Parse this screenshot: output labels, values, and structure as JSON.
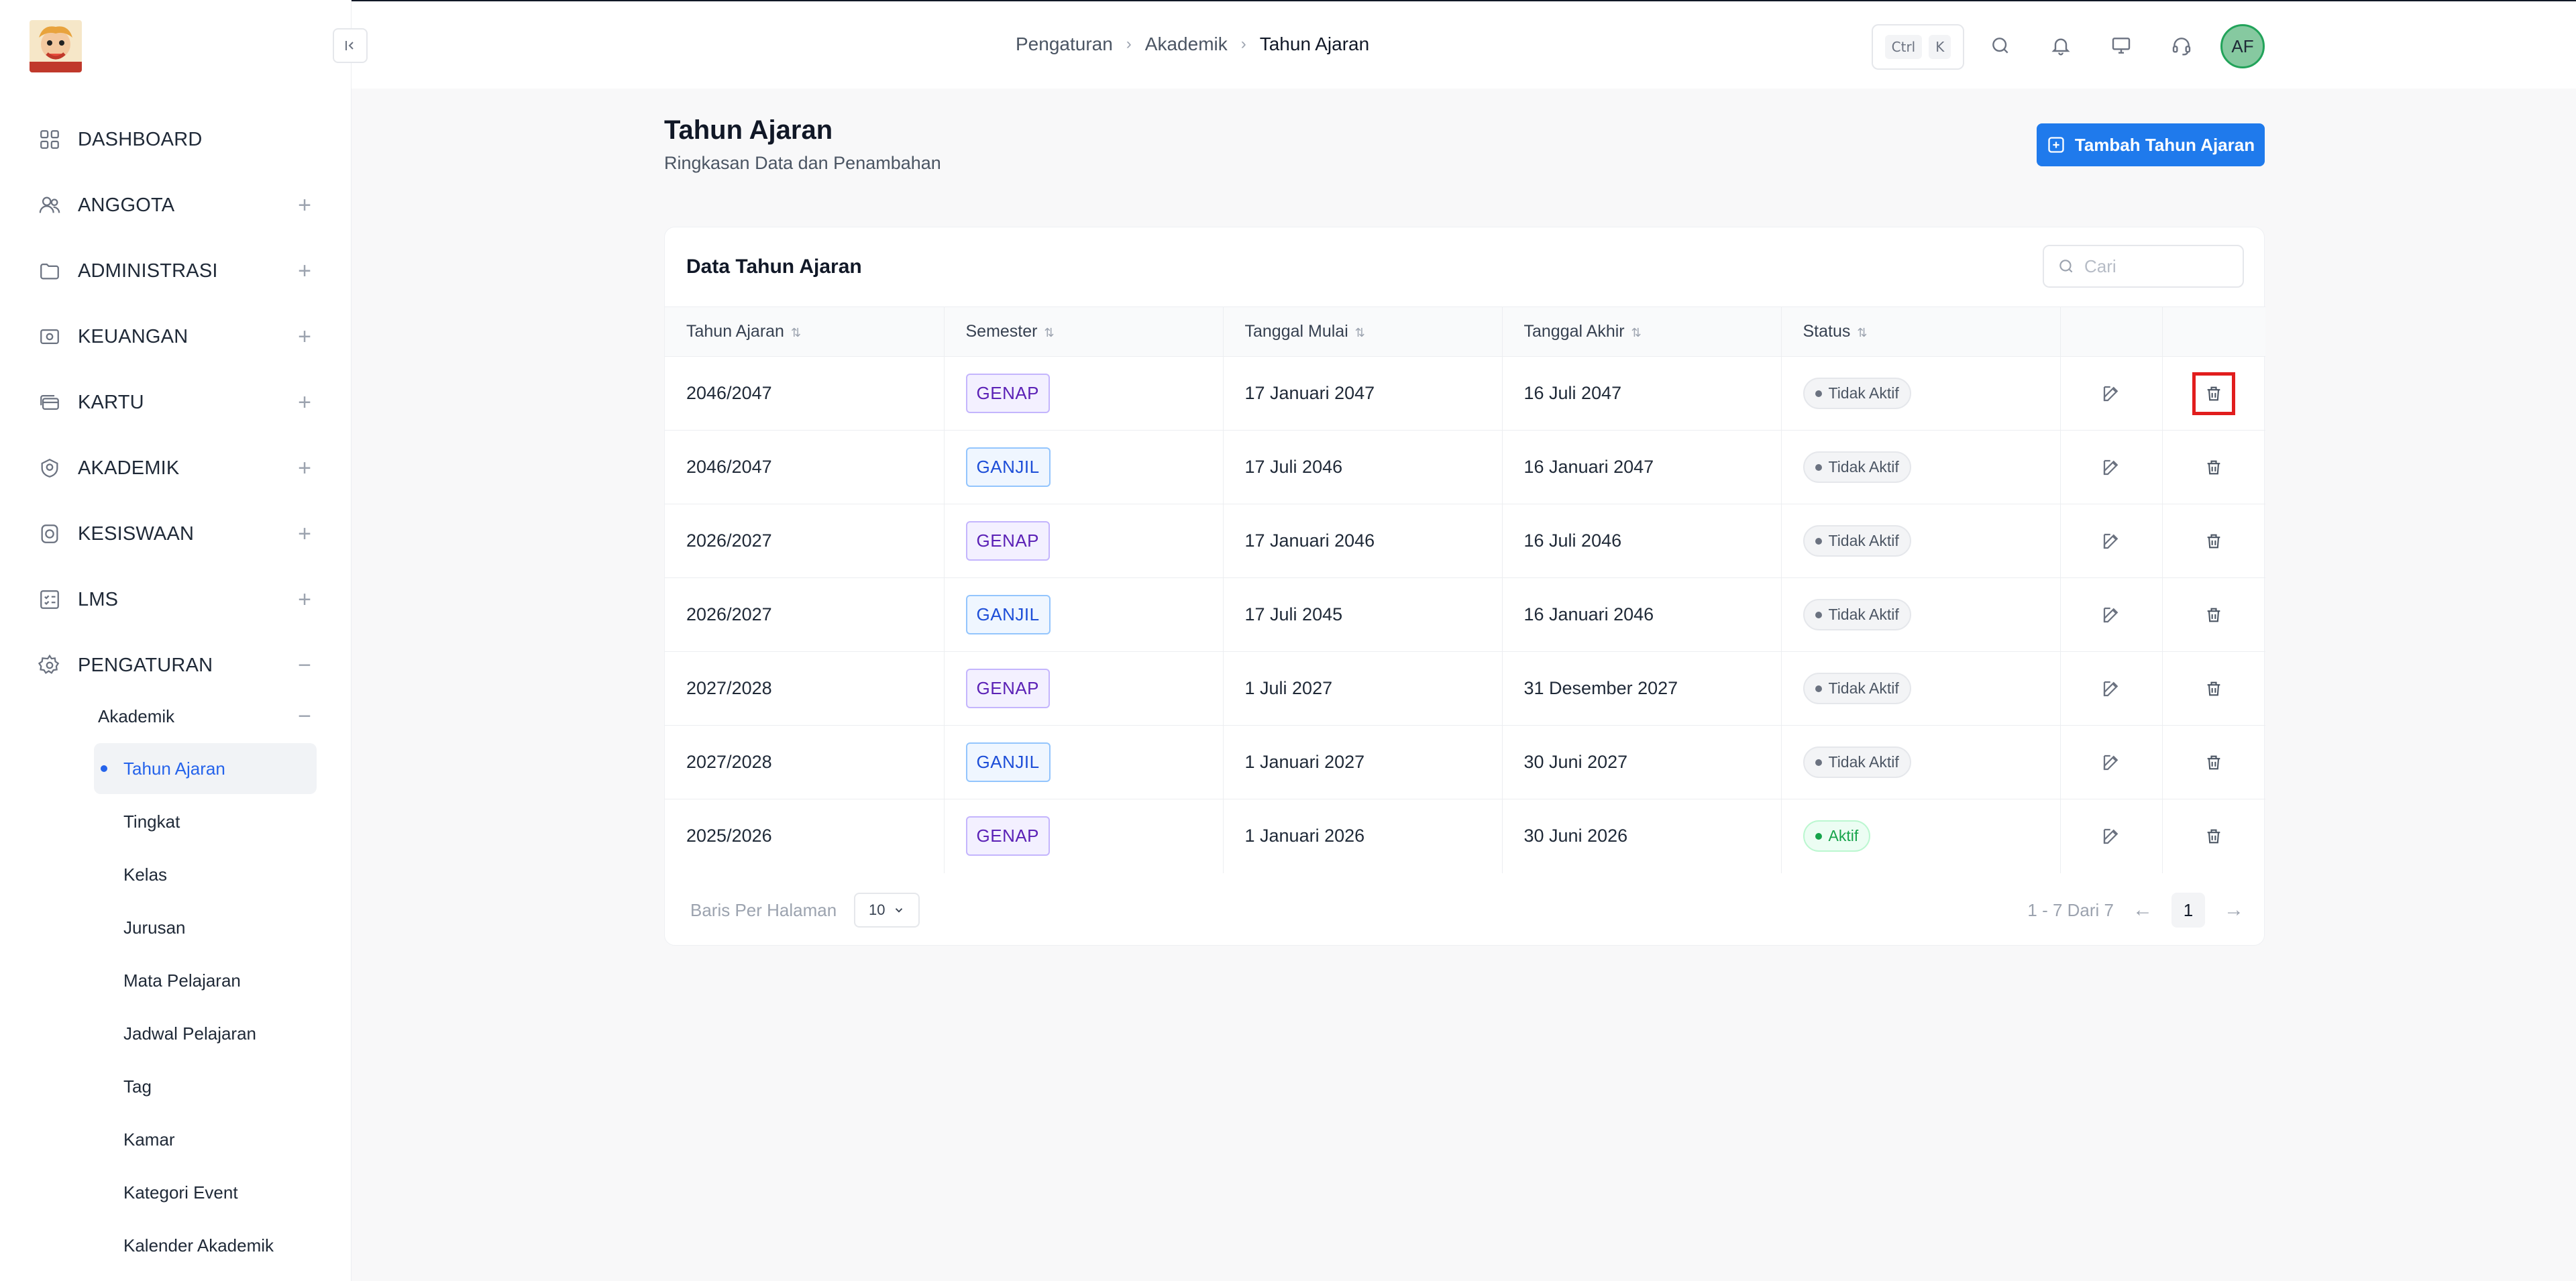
{
  "sidebar": {
    "collapse_icon": "collapse-left-icon",
    "items": [
      {
        "label": "DASHBOARD",
        "icon": "grid-icon",
        "expandable": false
      },
      {
        "label": "ANGGOTA",
        "icon": "users-icon",
        "expandable": true,
        "toggle": "+"
      },
      {
        "label": "ADMINISTRASI",
        "icon": "folder-icon",
        "expandable": true,
        "toggle": "+"
      },
      {
        "label": "KEUANGAN",
        "icon": "money-icon",
        "expandable": true,
        "toggle": "+"
      },
      {
        "label": "KARTU",
        "icon": "cards-icon",
        "expandable": true,
        "toggle": "+"
      },
      {
        "label": "AKADEMIK",
        "icon": "academic-icon",
        "expandable": true,
        "toggle": "+"
      },
      {
        "label": "KESISWAAN",
        "icon": "badge-icon",
        "expandable": true,
        "toggle": "+"
      },
      {
        "label": "LMS",
        "icon": "checklist-icon",
        "expandable": true,
        "toggle": "+"
      },
      {
        "label": "PENGATURAN",
        "icon": "gear-icon",
        "expandable": true,
        "toggle": "−"
      }
    ],
    "submenu": {
      "label": "Akademik",
      "toggle": "−",
      "items": [
        "Tahun Ajaran",
        "Tingkat",
        "Kelas",
        "Jurusan",
        "Mata Pelajaran",
        "Jadwal Pelajaran",
        "Tag",
        "Kamar",
        "Kategori Event",
        "Kalender Akademik"
      ],
      "active_index": 0
    }
  },
  "header": {
    "breadcrumb": [
      "Pengaturan",
      "Akademik",
      "Tahun Ajaran"
    ],
    "shortcut": [
      "Ctrl",
      "K"
    ],
    "avatar": "AF"
  },
  "main": {
    "title": "Tahun Ajaran",
    "subtitle": "Ringkasan Data dan Penambahan",
    "add_button": "Tambah Tahun Ajaran"
  },
  "table": {
    "title": "Data Tahun Ajaran",
    "search_placeholder": "Cari",
    "columns": [
      "Tahun Ajaran",
      "Semester",
      "Tanggal Mulai",
      "Tanggal Akhir",
      "Status"
    ],
    "rows": [
      {
        "tahun": "2046/2047",
        "semester": "GENAP",
        "mulai": "17 Januari 2047",
        "akhir": "16 Juli 2047",
        "status": "Tidak Aktif"
      },
      {
        "tahun": "2046/2047",
        "semester": "GANJIL",
        "mulai": "17 Juli 2046",
        "akhir": "16 Januari 2047",
        "status": "Tidak Aktif"
      },
      {
        "tahun": "2026/2027",
        "semester": "GENAP",
        "mulai": "17 Januari 2046",
        "akhir": "16 Juli 2046",
        "status": "Tidak Aktif"
      },
      {
        "tahun": "2026/2027",
        "semester": "GANJIL",
        "mulai": "17 Juli 2045",
        "akhir": "16 Januari 2046",
        "status": "Tidak Aktif"
      },
      {
        "tahun": "2027/2028",
        "semester": "GENAP",
        "mulai": "1 Juli 2027",
        "akhir": "31 Desember 2027",
        "status": "Tidak Aktif"
      },
      {
        "tahun": "2027/2028",
        "semester": "GANJIL",
        "mulai": "1 Januari 2027",
        "akhir": "30 Juni 2027",
        "status": "Tidak Aktif"
      },
      {
        "tahun": "2025/2026",
        "semester": "GENAP",
        "mulai": "1 Januari 2026",
        "akhir": "30 Juni 2026",
        "status": "Aktif"
      }
    ],
    "rows_per_page_label": "Baris Per Halaman",
    "rows_per_page": "10",
    "range": "1 - 7 Dari 7",
    "page": "1"
  },
  "colors": {
    "accent": "#1f7aec",
    "active": "#16a34a",
    "highlight": "#e11d1d"
  }
}
